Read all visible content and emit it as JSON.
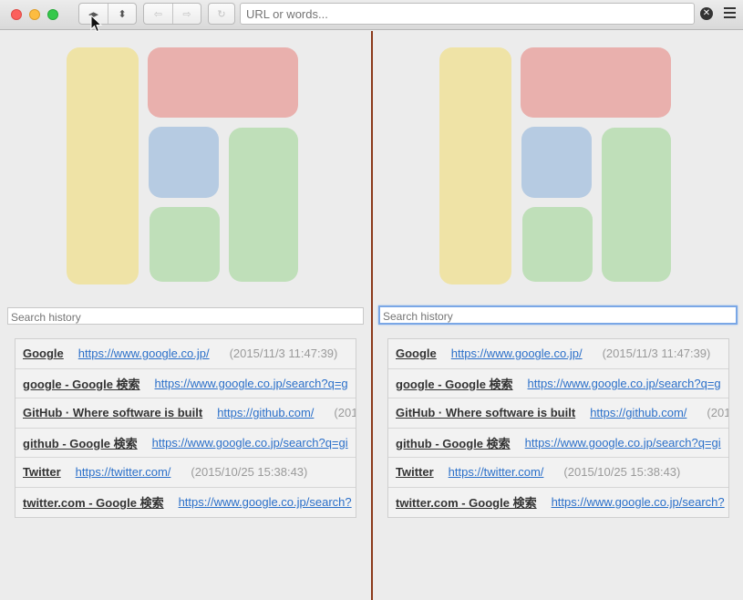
{
  "toolbar": {
    "back_forward_glyphs": "◂▸",
    "updown_glyph": "⬍",
    "back_glyph": "⇦",
    "forward_glyph": "⇨",
    "reload_glyph": "↻",
    "url_placeholder": "URL or words...",
    "clear_glyph": "✕"
  },
  "colors": {
    "divider": "#8b3a1b",
    "link": "#2a6fc9",
    "tile_yellow": "#efe3a6",
    "tile_red": "#e9b0ad",
    "tile_blue": "#b6cbe2",
    "tile_green": "#bfdfb9",
    "focus_ring": "#7aa7e6"
  },
  "panes": [
    {
      "search_placeholder": "Search history",
      "history": [
        {
          "title": "Google",
          "url": "https://www.google.co.jp/",
          "date": "(2015/11/3 11:47:39)"
        },
        {
          "title": "google - Google 検索",
          "url": "https://www.google.co.jp/search?q=g",
          "date": ""
        },
        {
          "title": "GitHub · Where software is built",
          "url": "https://github.com/",
          "date": "(201"
        },
        {
          "title": "github - Google 検索",
          "url": "https://www.google.co.jp/search?q=gi",
          "date": ""
        },
        {
          "title": "Twitter",
          "url": "https://twitter.com/",
          "date": "(2015/10/25 15:38:43)"
        },
        {
          "title": "twitter.com - Google 検索",
          "url": "https://www.google.co.jp/search?",
          "date": ""
        }
      ]
    },
    {
      "search_placeholder": "Search history",
      "history": [
        {
          "title": "Google",
          "url": "https://www.google.co.jp/",
          "date": "(2015/11/3 11:47:39)"
        },
        {
          "title": "google - Google 検索",
          "url": "https://www.google.co.jp/search?q=g",
          "date": ""
        },
        {
          "title": "GitHub · Where software is built",
          "url": "https://github.com/",
          "date": "(201"
        },
        {
          "title": "github - Google 検索",
          "url": "https://www.google.co.jp/search?q=gi",
          "date": ""
        },
        {
          "title": "Twitter",
          "url": "https://twitter.com/",
          "date": "(2015/10/25 15:38:43)"
        },
        {
          "title": "twitter.com - Google 検索",
          "url": "https://www.google.co.jp/search?",
          "date": ""
        }
      ]
    }
  ]
}
